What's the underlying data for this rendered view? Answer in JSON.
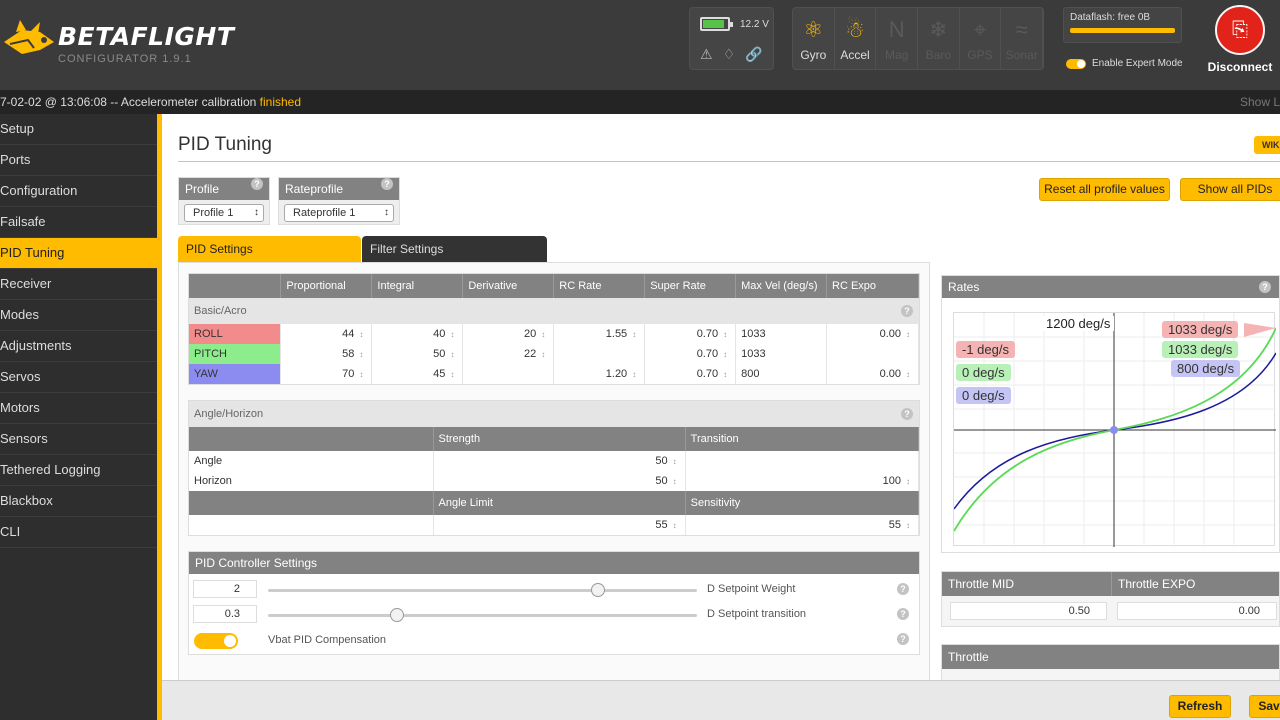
{
  "app": {
    "name": "BETAFLIGHT",
    "subtitle": "CONFIGURATOR  1.9.1"
  },
  "battery": {
    "voltage": "12.2 V",
    "level": 0.8,
    "color": "#59c24b"
  },
  "sensors": [
    {
      "name": "Gyro",
      "icon": "gyro-icon",
      "active": true
    },
    {
      "name": "Accel",
      "icon": "accel-icon",
      "active": true
    },
    {
      "name": "Mag",
      "icon": "mag-icon",
      "active": false
    },
    {
      "name": "Baro",
      "icon": "baro-icon",
      "active": false
    },
    {
      "name": "GPS",
      "icon": "gps-icon",
      "active": false
    },
    {
      "name": "Sonar",
      "icon": "sonar-icon",
      "active": false
    }
  ],
  "dataflash": {
    "label": "Dataflash: free 0B",
    "fill_fraction": 1.0
  },
  "expert_mode": {
    "label": "Enable Expert Mode",
    "on": true
  },
  "disconnect": {
    "label": "Disconnect"
  },
  "log": {
    "prefix": "7-02-02 @ 13:06:08 -- Accelerometer calibration ",
    "highlight": "finished",
    "show_log": "Show L"
  },
  "nav": [
    "Setup",
    "Ports",
    "Configuration",
    "Failsafe",
    "PID Tuning",
    "Receiver",
    "Modes",
    "Adjustments",
    "Servos",
    "Motors",
    "Sensors",
    "Tethered Logging",
    "Blackbox",
    "CLI"
  ],
  "nav_active": 4,
  "page": {
    "title": "PID Tuning",
    "wiki": "WIK"
  },
  "buttons": {
    "reset": "Reset all profile values",
    "show_pids": "Show all PIDs",
    "refresh": "Refresh",
    "save": "Sav"
  },
  "profile": {
    "label": "Profile",
    "value": "Profile 1"
  },
  "rateprofile": {
    "label": "Rateprofile",
    "value": "Rateprofile 1"
  },
  "tabs": {
    "pid": "PID Settings",
    "filter": "Filter Settings"
  },
  "pid_table": {
    "headers": [
      "",
      "Proportional",
      "Integral",
      "Derivative",
      "RC Rate",
      "Super Rate",
      "Max Vel (deg/s)",
      "RC Expo"
    ],
    "section": "Basic/Acro",
    "rows": [
      {
        "name": "ROLL",
        "color": "#f28b8b",
        "p": "44",
        "i": "40",
        "d": "20",
        "rc_rate": "1.55",
        "super": "0.70",
        "maxvel": "1033",
        "expo": "0.00"
      },
      {
        "name": "PITCH",
        "color": "#8ded8d",
        "p": "58",
        "i": "50",
        "d": "22",
        "rc_rate": "",
        "super": "0.70",
        "maxvel": "1033",
        "expo": ""
      },
      {
        "name": "YAW",
        "color": "#8c8cf0",
        "p": "70",
        "i": "45",
        "d": "",
        "rc_rate": "1.20",
        "super": "0.70",
        "maxvel": "800",
        "expo": "0.00"
      }
    ]
  },
  "angle_horizon": {
    "section": "Angle/Horizon",
    "col_strength": "Strength",
    "col_transition": "Transition",
    "angle_label": "Angle",
    "angle_strength": "50",
    "horizon_label": "Horizon",
    "horizon_strength": "50",
    "horizon_transition": "100",
    "col_limit": "Angle Limit",
    "col_sensitivity": "Sensitivity",
    "limit": "55",
    "sensitivity": "55"
  },
  "pid_controller": {
    "title": "PID Controller Settings",
    "setpoint_weight": {
      "value": "2",
      "label": "D Setpoint Weight",
      "slider": 0.77
    },
    "setpoint_transition": {
      "value": "0.3",
      "label": "D Setpoint transition",
      "slider": 0.3
    },
    "vbat": {
      "label": "Vbat PID Compensation",
      "on": true
    }
  },
  "rates_panel": {
    "title": "Rates",
    "max_label": "1200 deg/s",
    "left_tags": [
      {
        "text": "-1 deg/s",
        "color": "#f5b3b3"
      },
      {
        "text": "0 deg/s",
        "color": "#b8f0b8"
      },
      {
        "text": "0 deg/s",
        "color": "#c5c5f5"
      }
    ],
    "right_tags": [
      {
        "text": "1033 deg/s",
        "color": "#f5b3b3"
      },
      {
        "text": "1033 deg/s",
        "color": "#b8f0b8"
      },
      {
        "text": "800 deg/s",
        "color": "#c5c5f5"
      }
    ]
  },
  "throttle_mid": {
    "label": "Throttle MID",
    "value": "0.50"
  },
  "throttle_expo": {
    "label": "Throttle EXPO",
    "value": "0.00"
  },
  "throttle": {
    "label": "Throttle"
  }
}
